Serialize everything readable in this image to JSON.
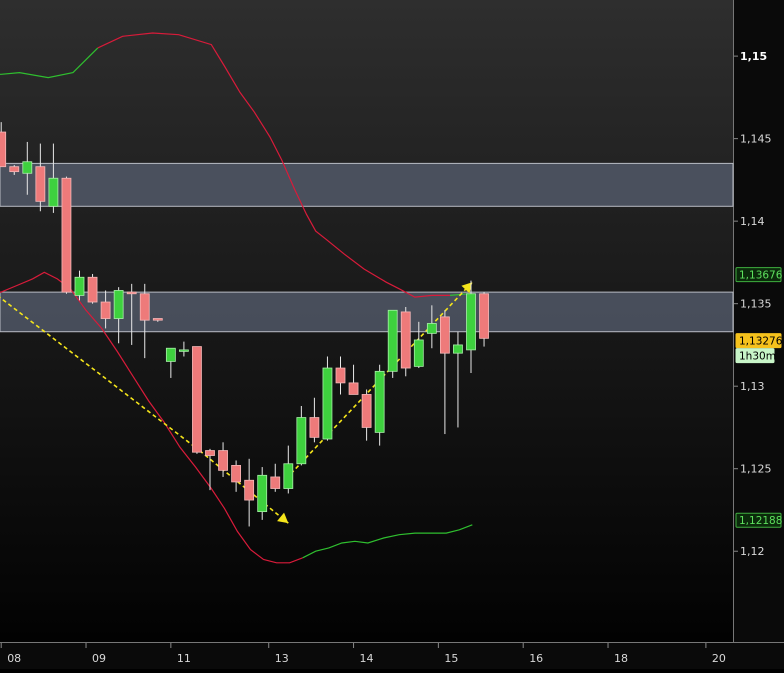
{
  "chart_data": {
    "type": "candlestick",
    "timeframe": "1h30m",
    "y_axis": {
      "range": [
        1.1145,
        1.1534
      ],
      "ticks": [
        {
          "value": 1.15,
          "label": "1,15",
          "major": true
        },
        {
          "value": 1.145,
          "label": "1,145"
        },
        {
          "value": 1.14,
          "label": "1,14"
        },
        {
          "value": 1.135,
          "label": "1,135"
        },
        {
          "value": 1.13,
          "label": "1,13"
        },
        {
          "value": 1.125,
          "label": "1,125"
        },
        {
          "value": 1.12,
          "label": "1,12"
        }
      ]
    },
    "x_axis": {
      "ticks": [
        {
          "index": 0,
          "label": "08"
        },
        {
          "index": 6.5,
          "label": "09"
        },
        {
          "index": 13,
          "label": "11"
        },
        {
          "index": 20.5,
          "label": "13"
        },
        {
          "index": 27,
          "label": "14"
        },
        {
          "index": 33.5,
          "label": "15"
        },
        {
          "index": 40,
          "label": "16"
        },
        {
          "index": 46.5,
          "label": "18"
        },
        {
          "index": 54,
          "label": "20"
        }
      ]
    },
    "zones": [
      {
        "from": 1.1409,
        "to": 1.1435
      },
      {
        "from": 1.1333,
        "to": 1.1357
      }
    ],
    "candles": [
      {
        "o": 1.1454,
        "h": 1.146,
        "l": 1.1434,
        "c": 1.1433
      },
      {
        "o": 1.1433,
        "h": 1.1434,
        "l": 1.1428,
        "c": 1.143
      },
      {
        "o": 1.1429,
        "h": 1.1448,
        "l": 1.1416,
        "c": 1.1436
      },
      {
        "o": 1.1433,
        "h": 1.1447,
        "l": 1.1406,
        "c": 1.1412
      },
      {
        "o": 1.1409,
        "h": 1.1447,
        "l": 1.1405,
        "c": 1.1426
      },
      {
        "o": 1.1426,
        "h": 1.1427,
        "l": 1.1356,
        "c": 1.1357
      },
      {
        "o": 1.1355,
        "h": 1.137,
        "l": 1.1352,
        "c": 1.1366
      },
      {
        "o": 1.1366,
        "h": 1.1368,
        "l": 1.135,
        "c": 1.1351
      },
      {
        "o": 1.1351,
        "h": 1.1358,
        "l": 1.1335,
        "c": 1.1341
      },
      {
        "o": 1.1341,
        "h": 1.136,
        "l": 1.1326,
        "c": 1.1358
      },
      {
        "o": 1.1357,
        "h": 1.1362,
        "l": 1.1325,
        "c": 1.1356
      },
      {
        "o": 1.1356,
        "h": 1.1362,
        "l": 1.1317,
        "c": 1.134
      },
      {
        "o": 1.1341,
        "h": 1.1341,
        "l": 1.1339,
        "c": 1.134
      },
      {
        "o": 1.1315,
        "h": 1.1316,
        "l": 1.1305,
        "c": 1.1323
      },
      {
        "o": 1.1322,
        "h": 1.1327,
        "l": 1.1318,
        "c": 1.1322
      },
      {
        "o": 1.1324,
        "h": 1.1324,
        "l": 1.1259,
        "c": 1.126
      },
      {
        "o": 1.1261,
        "h": 1.1262,
        "l": 1.1237,
        "c": 1.1258
      },
      {
        "o": 1.1261,
        "h": 1.1266,
        "l": 1.1245,
        "c": 1.1249
      },
      {
        "o": 1.1252,
        "h": 1.1255,
        "l": 1.1236,
        "c": 1.1242
      },
      {
        "o": 1.1243,
        "h": 1.1256,
        "l": 1.1215,
        "c": 1.1231
      },
      {
        "o": 1.1224,
        "h": 1.1251,
        "l": 1.1219,
        "c": 1.1246
      },
      {
        "o": 1.1245,
        "h": 1.1253,
        "l": 1.1236,
        "c": 1.1238
      },
      {
        "o": 1.1238,
        "h": 1.1264,
        "l": 1.1235,
        "c": 1.1253
      },
      {
        "o": 1.1253,
        "h": 1.1288,
        "l": 1.1252,
        "c": 1.1281
      },
      {
        "o": 1.1281,
        "h": 1.1293,
        "l": 1.1266,
        "c": 1.1269
      },
      {
        "o": 1.1268,
        "h": 1.1318,
        "l": 1.1267,
        "c": 1.1311
      },
      {
        "o": 1.1311,
        "h": 1.1318,
        "l": 1.1295,
        "c": 1.1302
      },
      {
        "o": 1.1302,
        "h": 1.1313,
        "l": 1.1295,
        "c": 1.1295
      },
      {
        "o": 1.1295,
        "h": 1.1298,
        "l": 1.1267,
        "c": 1.1275
      },
      {
        "o": 1.1272,
        "h": 1.1313,
        "l": 1.1264,
        "c": 1.1309
      },
      {
        "o": 1.1309,
        "h": 1.1346,
        "l": 1.1305,
        "c": 1.1346
      },
      {
        "o": 1.1345,
        "h": 1.1348,
        "l": 1.1306,
        "c": 1.1311
      },
      {
        "o": 1.1312,
        "h": 1.1339,
        "l": 1.1311,
        "c": 1.1328
      },
      {
        "o": 1.1332,
        "h": 1.1349,
        "l": 1.1323,
        "c": 1.1338
      },
      {
        "o": 1.1342,
        "h": 1.1346,
        "l": 1.1271,
        "c": 1.132
      },
      {
        "o": 1.132,
        "h": 1.1333,
        "l": 1.1275,
        "c": 1.1325
      },
      {
        "o": 1.1322,
        "h": 1.1364,
        "l": 1.1308,
        "c": 1.1356
      },
      {
        "o": 1.1356,
        "h": 1.1357,
        "l": 1.1324,
        "c": 1.1329
      }
    ],
    "bollinger_upper": [
      [
        -2,
        1.1489
      ],
      [
        0,
        1.1489
      ],
      [
        1.4,
        1.149
      ],
      [
        3.6,
        1.1487
      ],
      [
        5.5,
        1.149
      ],
      [
        7.4,
        1.1505
      ],
      [
        9.3,
        1.1512
      ],
      [
        11.6,
        1.1514
      ],
      [
        13.6,
        1.1513
      ],
      [
        16.1,
        1.1507
      ],
      [
        17.1,
        1.1494
      ],
      [
        18.3,
        1.1478
      ],
      [
        19.4,
        1.1466
      ],
      [
        20.6,
        1.1451
      ],
      [
        21.5,
        1.1437
      ],
      [
        22.5,
        1.1419
      ],
      [
        23.4,
        1.1404
      ],
      [
        24.1,
        1.1394
      ],
      [
        24.9,
        1.1389
      ],
      [
        26.3,
        1.138
      ],
      [
        27.8,
        1.1371
      ],
      [
        29.5,
        1.1363
      ],
      [
        30.5,
        1.1359
      ],
      [
        31.7,
        1.1354
      ],
      [
        33,
        1.1355
      ],
      [
        34.4,
        1.1355
      ],
      [
        35.8,
        1.1356
      ]
    ],
    "bollinger_lower": [
      [
        -2,
        1.1355
      ],
      [
        0,
        1.1357
      ],
      [
        1.2,
        1.1361
      ],
      [
        2.4,
        1.1365
      ],
      [
        3.3,
        1.1369
      ],
      [
        4.3,
        1.1365
      ],
      [
        5.3,
        1.1359
      ],
      [
        6.5,
        1.1346
      ],
      [
        7.7,
        1.1335
      ],
      [
        8.9,
        1.1321
      ],
      [
        10.1,
        1.1306
      ],
      [
        11.3,
        1.1291
      ],
      [
        12.5,
        1.1278
      ],
      [
        13.7,
        1.1263
      ],
      [
        14.9,
        1.1251
      ],
      [
        16.1,
        1.1238
      ],
      [
        17.1,
        1.1226
      ],
      [
        18.1,
        1.1212
      ],
      [
        19.1,
        1.1201
      ],
      [
        20.1,
        1.1195
      ],
      [
        21.1,
        1.1193
      ],
      [
        22.1,
        1.1193
      ],
      [
        23.1,
        1.1196
      ],
      [
        24.1,
        1.12
      ],
      [
        25.1,
        1.1202
      ],
      [
        26.1,
        1.1205
      ],
      [
        27.1,
        1.1206
      ],
      [
        28.1,
        1.1205
      ],
      [
        29.3,
        1.1208
      ],
      [
        30.5,
        1.121
      ],
      [
        31.7,
        1.1211
      ],
      [
        32.9,
        1.1211
      ],
      [
        34.1,
        1.1211
      ],
      [
        35.1,
        1.1213
      ],
      [
        36.1,
        1.1216
      ]
    ],
    "bollinger_segments": {
      "upper_green_before": 6.9,
      "upper_green_after": 33.7,
      "lower_green_after": 22.5
    },
    "trendlines": [
      {
        "from": [
          -0.3,
          1.1355
        ],
        "to": [
          15.2,
          1.1261
        ],
        "arrow": false
      },
      {
        "from": [
          15.2,
          1.1261
        ],
        "to": [
          22,
          1.1217
        ],
        "arrow": true
      },
      {
        "from": [
          22.2,
          1.1247
        ],
        "to": [
          36.1,
          1.1363
        ],
        "arrow": true
      }
    ],
    "price_labels": [
      {
        "value": 1.13676,
        "text": "1,13676",
        "style": "green-box"
      },
      {
        "value": 1.13276,
        "text": "1,13276",
        "style": "yellow-box"
      },
      {
        "value": 1.12188,
        "text": "1,12188",
        "style": "green-box"
      }
    ],
    "timeframe_label": "1h30m"
  }
}
